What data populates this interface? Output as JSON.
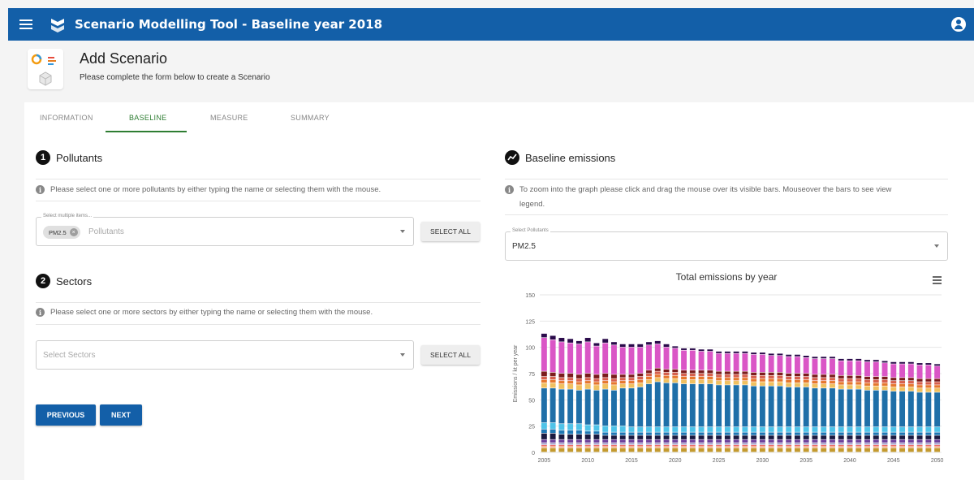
{
  "app": {
    "title": "Scenario Modelling Tool - Baseline year 2018"
  },
  "header": {
    "title": "Add Scenario",
    "subtitle": "Please complete the form below to create a Scenario"
  },
  "tabs": [
    {
      "label": "INFORMATION",
      "active": false
    },
    {
      "label": "BASELINE",
      "active": true
    },
    {
      "label": "MEASURE",
      "active": false
    },
    {
      "label": "SUMMARY",
      "active": false
    }
  ],
  "pollutants": {
    "step": "1",
    "title": "Pollutants",
    "info": "Please select one or more pollutants by either typing the name or selecting them with the mouse.",
    "legend": "Select multiple items...",
    "chip": "PM2.5",
    "placeholder": "Pollutants",
    "select_all": "SELECT ALL"
  },
  "sectors": {
    "step": "2",
    "title": "Sectors",
    "info": "Please select one or more sectors by either typing the name or selecting them with the mouse.",
    "placeholder": "Select Sectors",
    "select_all": "SELECT ALL"
  },
  "buttons": {
    "previous": "PREVIOUS",
    "next": "NEXT"
  },
  "baseline": {
    "title": "Baseline emissions",
    "info_line1": "To zoom into the graph please click and drag the mouse over its visible bars. Mouseover the bars to see view",
    "info_line2": "legend.",
    "select_legend": "Select Pollutants",
    "select_value": "PM2.5"
  },
  "colors": {
    "primary": "#135fa8",
    "active_tab": "#2e7d32"
  },
  "chart_data": {
    "type": "bar",
    "stacked": true,
    "title": "Total emissions by year",
    "ylabel": "Emissions / kt per year",
    "xlabel": "",
    "ylim": [
      0,
      150
    ],
    "yticks": [
      0,
      25,
      50,
      75,
      100,
      125,
      150
    ],
    "xticks": [
      2005,
      2010,
      2015,
      2020,
      2025,
      2030,
      2035,
      2040,
      2045,
      2050
    ],
    "grid": true,
    "legend": "none",
    "x": [
      2005,
      2006,
      2007,
      2008,
      2009,
      2010,
      2011,
      2012,
      2013,
      2014,
      2015,
      2016,
      2017,
      2018,
      2019,
      2020,
      2021,
      2022,
      2023,
      2024,
      2025,
      2026,
      2027,
      2028,
      2029,
      2030,
      2031,
      2032,
      2033,
      2034,
      2035,
      2036,
      2037,
      2038,
      2039,
      2040,
      2041,
      2042,
      2043,
      2044,
      2045,
      2046,
      2047,
      2048,
      2049,
      2050
    ],
    "series": [
      {
        "color": "#c49a2e",
        "values": [
          4,
          4,
          4,
          4,
          4,
          4,
          4,
          4,
          4,
          4,
          4,
          4,
          4,
          4,
          4,
          4,
          4,
          4,
          4,
          4,
          4,
          4,
          4,
          4,
          4,
          4,
          4,
          4,
          4,
          4,
          4,
          4,
          4,
          4,
          4,
          4,
          4,
          4,
          4,
          4,
          4,
          4,
          4,
          4,
          4,
          4
        ]
      },
      {
        "color": "#f4a582",
        "values": [
          2,
          2,
          2,
          2,
          2,
          2,
          2,
          2,
          2,
          2,
          2,
          2,
          2,
          2,
          2,
          2,
          2,
          2,
          2,
          2,
          2,
          2,
          2,
          2,
          2,
          2,
          2,
          2,
          2,
          2,
          2,
          2,
          2,
          2,
          2,
          2,
          2,
          2,
          2,
          2,
          2,
          2,
          2,
          2,
          2,
          2
        ]
      },
      {
        "color": "#e41a1c",
        "values": [
          1,
          1,
          1,
          1,
          1,
          1,
          1,
          1,
          1,
          1,
          1,
          1,
          1,
          1,
          1,
          1,
          1,
          1,
          1,
          1,
          1,
          1,
          1,
          1,
          1,
          1,
          1,
          1,
          1,
          1,
          1,
          1,
          1,
          1,
          1,
          1,
          1,
          1,
          1,
          1,
          1,
          1,
          1,
          1,
          1,
          1
        ]
      },
      {
        "color": "#9e9ac8",
        "values": [
          2,
          2,
          2,
          2,
          2,
          2,
          2,
          2,
          2,
          2,
          2,
          2,
          2,
          2,
          2,
          2,
          2,
          2,
          2,
          2,
          2,
          2,
          2,
          2,
          2,
          2,
          2,
          2,
          2,
          2,
          2,
          2,
          2,
          2,
          2,
          2,
          2,
          2,
          2,
          2,
          2,
          2,
          2,
          2,
          2,
          2
        ]
      },
      {
        "color": "#6a3d9a",
        "values": [
          3,
          3,
          3,
          3,
          3,
          3,
          3,
          3,
          3,
          3,
          3,
          3,
          3,
          3,
          3,
          3,
          3,
          3,
          3,
          3,
          3,
          3,
          3,
          3,
          3,
          3,
          3,
          3,
          3,
          3,
          3,
          3,
          3,
          3,
          3,
          3,
          3,
          3,
          3,
          3,
          3,
          3,
          3,
          3,
          3,
          3
        ]
      },
      {
        "color": "#1a1a40",
        "values": [
          6,
          6,
          5,
          5,
          5,
          5,
          5,
          4,
          4,
          4,
          4,
          4,
          4,
          4,
          4,
          4,
          4,
          4,
          4,
          4,
          4,
          4,
          4,
          4,
          4,
          4,
          4,
          4,
          4,
          4,
          4,
          4,
          4,
          4,
          4,
          4,
          4,
          4,
          4,
          4,
          4,
          4,
          4,
          4,
          4,
          4
        ]
      },
      {
        "color": "#1f78b4",
        "values": [
          4,
          4,
          4,
          4,
          4,
          3,
          3,
          3,
          3,
          3,
          3,
          3,
          3,
          3,
          3,
          3,
          3,
          3,
          3,
          3,
          3,
          3,
          3,
          3,
          3,
          3,
          3,
          3,
          3,
          3,
          3,
          3,
          3,
          3,
          3,
          3,
          3,
          3,
          3,
          3,
          3,
          3,
          3,
          3,
          3,
          3
        ]
      },
      {
        "color": "#4fc3e8",
        "values": [
          6,
          6,
          6,
          6,
          6,
          6,
          6,
          6,
          6,
          6,
          5,
          5,
          5,
          5,
          5,
          5,
          5,
          5,
          5,
          5,
          5,
          5,
          5,
          5,
          5,
          5,
          5,
          5,
          5,
          5,
          5,
          5,
          5,
          5,
          5,
          5,
          5,
          5,
          5,
          5,
          5,
          5,
          5,
          5,
          5,
          5
        ]
      },
      {
        "color": "#1f6fa8",
        "values": [
          33,
          33,
          33,
          33,
          32,
          34,
          33,
          35,
          34,
          36,
          37,
          38,
          41,
          43,
          42,
          42,
          41,
          41,
          41,
          41,
          40,
          40,
          40,
          40,
          39,
          39,
          39,
          39,
          38,
          38,
          38,
          37,
          37,
          37,
          36,
          36,
          36,
          35,
          35,
          35,
          34,
          34,
          34,
          33,
          33,
          33
        ]
      },
      {
        "color": "#f0c060",
        "values": [
          5,
          5,
          5,
          5,
          5,
          5,
          5,
          5,
          5,
          4,
          4,
          4,
          4,
          4,
          4,
          4,
          4,
          4,
          4,
          4,
          4,
          4,
          4,
          4,
          4,
          4,
          4,
          4,
          4,
          4,
          4,
          4,
          4,
          4,
          4,
          4,
          4,
          4,
          4,
          4,
          4,
          4,
          4,
          4,
          4,
          4
        ]
      },
      {
        "color": "#e6772e",
        "values": [
          3,
          3,
          3,
          3,
          3,
          3,
          3,
          3,
          3,
          3,
          3,
          3,
          3,
          3,
          3,
          3,
          3,
          3,
          3,
          3,
          3,
          3,
          3,
          3,
          3,
          3,
          3,
          3,
          3,
          3,
          3,
          3,
          3,
          3,
          3,
          3,
          3,
          3,
          3,
          3,
          3,
          3,
          3,
          3,
          3,
          3
        ]
      },
      {
        "color": "#d6604d",
        "values": [
          3,
          3,
          3,
          3,
          3,
          3,
          3,
          3,
          3,
          3,
          3,
          3,
          3,
          3,
          3,
          3,
          3,
          3,
          3,
          3,
          3,
          3,
          3,
          3,
          3,
          3,
          3,
          3,
          3,
          3,
          3,
          3,
          3,
          3,
          3,
          3,
          3,
          3,
          3,
          3,
          3,
          3,
          3,
          3,
          3,
          3
        ]
      },
      {
        "color": "#7b1c1c",
        "values": [
          5,
          4,
          4,
          4,
          4,
          4,
          4,
          4,
          4,
          3,
          3,
          3,
          3,
          3,
          3,
          3,
          3,
          3,
          3,
          3,
          3,
          3,
          3,
          3,
          3,
          3,
          3,
          3,
          3,
          3,
          3,
          3,
          3,
          3,
          3,
          3,
          3,
          3,
          3,
          3,
          3,
          3,
          3,
          3,
          3,
          3
        ]
      },
      {
        "color": "#da56c6",
        "values": [
          32,
          31,
          30,
          29,
          29,
          30,
          27,
          29,
          28,
          26,
          26,
          25,
          24,
          23,
          21,
          20,
          19,
          19,
          18,
          18,
          17,
          17,
          17,
          17,
          17,
          17,
          16,
          16,
          16,
          16,
          15,
          15,
          15,
          15,
          14,
          14,
          14,
          14,
          14,
          13,
          13,
          13,
          13,
          13,
          13,
          12
        ]
      },
      {
        "color": "#2a0a4a",
        "values": [
          4,
          4,
          4,
          4,
          3,
          4,
          3,
          4,
          3,
          3,
          3,
          3,
          3,
          3,
          3,
          2,
          2,
          2,
          2,
          2,
          2,
          2,
          2,
          2,
          2,
          2,
          2,
          2,
          2,
          2,
          2,
          2,
          2,
          2,
          2,
          2,
          2,
          2,
          2,
          2,
          2,
          2,
          2,
          2,
          2,
          2
        ]
      }
    ]
  }
}
